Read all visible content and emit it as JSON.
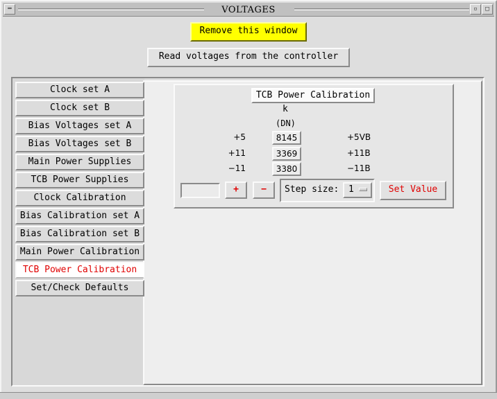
{
  "window": {
    "title": "VOLTAGES",
    "menu_glyph": "═",
    "minimize_glyph": "▫",
    "maximize_glyph": "□"
  },
  "toolbar": {
    "remove_label": "Remove this window",
    "read_label": "Read voltages from the controller"
  },
  "tabs": [
    {
      "label": "Clock set A"
    },
    {
      "label": "Clock set B"
    },
    {
      "label": "Bias Voltages set A"
    },
    {
      "label": "Bias Voltages set B"
    },
    {
      "label": "Main Power Supplies"
    },
    {
      "label": "TCB Power Supplies"
    },
    {
      "label": "Clock Calibration"
    },
    {
      "label": "Bias Calibration set A"
    },
    {
      "label": "Bias Calibration set B"
    },
    {
      "label": "Main Power Calibration"
    },
    {
      "label": "TCB Power Calibration",
      "active": true
    },
    {
      "label": "Set/Check Defaults"
    }
  ],
  "calibration": {
    "heading": "TCB Power Calibration",
    "k_label": "k",
    "dn_label": "(DN)",
    "rows": [
      {
        "left": "+5",
        "value": "8145",
        "right": "+5VB"
      },
      {
        "left": "+11",
        "value": "3369",
        "right": "+11B"
      },
      {
        "left": "−11",
        "value": "3380",
        "right": "−11B"
      }
    ]
  },
  "controls": {
    "entry_value": "",
    "plus_label": "+",
    "minus_label": "−",
    "step_label": "Step size:",
    "step_value": "1",
    "set_value_label": "Set Value"
  },
  "colors": {
    "accent_red": "#e00000",
    "remove_bg": "#ffff00",
    "active_tab_bg": "#ffffff"
  }
}
